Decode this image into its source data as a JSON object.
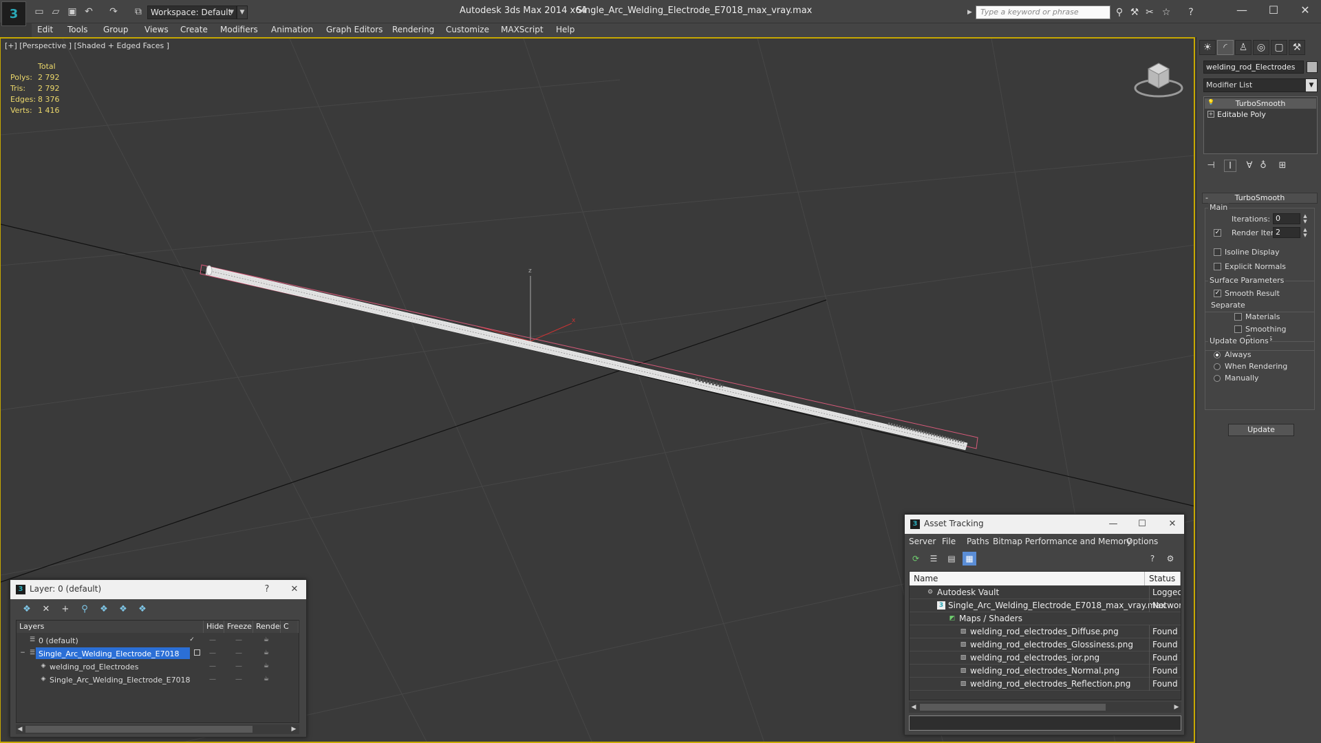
{
  "titlebar": {
    "workspace": "Workspace: Default",
    "app_title": "Autodesk 3ds Max  2014 x64",
    "doc_title": "Single_Arc_Welding_Electrode_E7018_max_vray.max",
    "search_placeholder": "Type a keyword or phrase"
  },
  "menu": [
    "Edit",
    "Tools",
    "Group",
    "Views",
    "Create",
    "Modifiers",
    "Animation",
    "Graph Editors",
    "Rendering",
    "Customize",
    "MAXScript",
    "Help"
  ],
  "viewport": {
    "label": "[+] [Perspective ] [Shaded + Edged Faces ]",
    "stats": {
      "header": "Total",
      "rows": [
        {
          "label": "Polys:",
          "value": "2 792"
        },
        {
          "label": "Tris:",
          "value": "2 792"
        },
        {
          "label": "Edges:",
          "value": "8 376"
        },
        {
          "label": "Verts:",
          "value": "1 416"
        }
      ]
    },
    "accent_color": "#c7a800",
    "stats_color": "#ecd86b",
    "axis_labels": {
      "z": "z",
      "x": "x"
    }
  },
  "command_panel": {
    "object_name": "welding_rod_Electrodes",
    "modifier_list": "Modifier List",
    "stack": [
      "TurboSmooth",
      "Editable Poly"
    ],
    "rollout_title": "TurboSmooth",
    "main": {
      "title": "Main",
      "iterations_label": "Iterations:",
      "iterations_value": "0",
      "render_iters_label": "Render Iters:",
      "render_iters_value": "2",
      "render_iters_checked": true,
      "isoline_label": "Isoline Display",
      "explicit_normals_label": "Explicit Normals"
    },
    "surface": {
      "title": "Surface Parameters",
      "smooth_result_label": "Smooth Result",
      "smooth_result_checked": true,
      "separate_label": "Separate",
      "materials_label": "Materials",
      "smoothing_groups_label": "Smoothing Groups"
    },
    "update": {
      "title": "Update Options",
      "options": [
        "Always",
        "When Rendering",
        "Manually"
      ],
      "selected": "Always",
      "button": "Update"
    }
  },
  "layer_window": {
    "title": "Layer: 0 (default)",
    "help": "?",
    "columns": [
      "Layers",
      "Hide",
      "Freeze",
      "Render",
      "C"
    ],
    "rows": [
      {
        "name": "0 (default)",
        "indent": 0,
        "current": true
      },
      {
        "name": "Single_Arc_Welding_Electrode_E7018",
        "indent": 0,
        "selected": true
      },
      {
        "name": "welding_rod_Electrodes",
        "indent": 1
      },
      {
        "name": "Single_Arc_Welding_Electrode_E7018",
        "indent": 1
      }
    ]
  },
  "asset_window": {
    "title": "Asset Tracking",
    "menu": [
      "Server",
      "File",
      "Paths",
      "Bitmap Performance and Memory",
      "Options"
    ],
    "columns": [
      "Name",
      "Status"
    ],
    "rows": [
      {
        "name": "Autodesk Vault",
        "status": "Logged O",
        "indent": 1
      },
      {
        "name": "Single_Arc_Welding_Electrode_E7018_max_vray.max",
        "status": "Network",
        "indent": 2
      },
      {
        "name": "Maps / Shaders",
        "status": "",
        "indent": 3
      },
      {
        "name": "welding_rod_electrodes_Diffuse.png",
        "status": "Found",
        "indent": 4
      },
      {
        "name": "welding_rod_electrodes_Glossiness.png",
        "status": "Found",
        "indent": 4
      },
      {
        "name": "welding_rod_electrodes_ior.png",
        "status": "Found",
        "indent": 4
      },
      {
        "name": "welding_rod_electrodes_Normal.png",
        "status": "Found",
        "indent": 4
      },
      {
        "name": "welding_rod_electrodes_Reflection.png",
        "status": "Found",
        "indent": 4
      }
    ]
  }
}
